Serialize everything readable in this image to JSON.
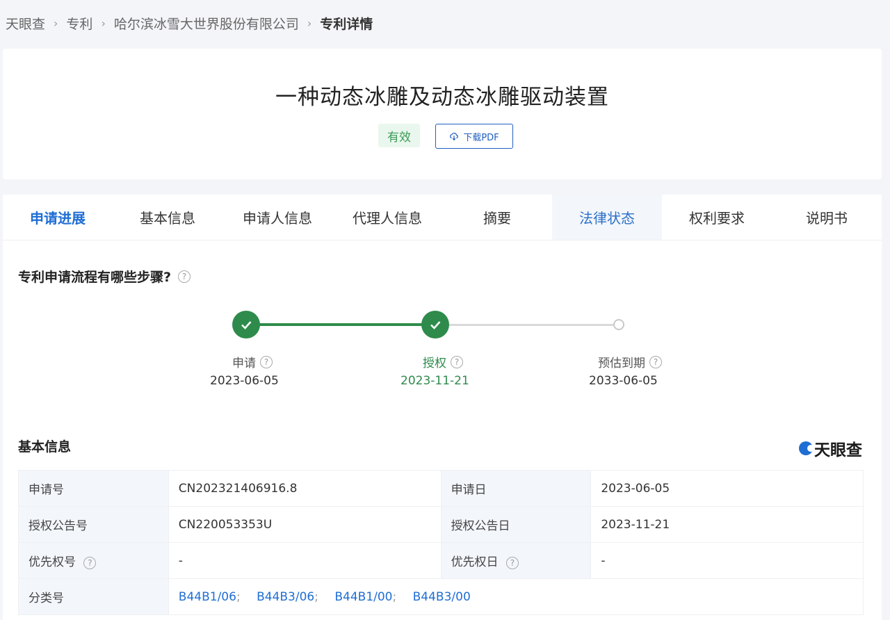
{
  "breadcrumb": {
    "items": [
      "天眼查",
      "专利",
      "哈尔滨冰雪大世界股份有限公司"
    ],
    "current": "专利详情",
    "separator": "›"
  },
  "patent": {
    "title": "一种动态冰雕及动态冰雕驱动装置",
    "status": "有效",
    "download_label": "下载PDF"
  },
  "tabs": [
    "申请进展",
    "基本信息",
    "申请人信息",
    "代理人信息",
    "摘要",
    "法律状态",
    "权利要求",
    "说明书"
  ],
  "progress": {
    "title": "专利申请流程有哪些步骤?",
    "steps": [
      {
        "label": "申请",
        "date": "2023-06-05",
        "done": true
      },
      {
        "label": "授权",
        "date": "2023-11-21",
        "done": true
      },
      {
        "label": "预估到期",
        "date": "2033-06-05",
        "done": false
      }
    ]
  },
  "basic_info": {
    "title": "基本信息",
    "logo_text": "天眼查",
    "rows": [
      {
        "l1": "申请号",
        "v1": "CN202321406916.8",
        "l2": "申请日",
        "v2": "2023-06-05"
      },
      {
        "l1": "授权公告号",
        "v1": "CN220053353U",
        "l2": "授权公告日",
        "v2": "2023-11-21"
      },
      {
        "l1": "优先权号",
        "v1": "-",
        "l2": "优先权日",
        "v2": "-"
      }
    ],
    "classification_label": "分类号",
    "classifications": [
      "B44B1/06",
      "B44B3/06",
      "B44B1/00",
      "B44B3/00"
    ]
  },
  "colors": {
    "accent": "#1f6ed4",
    "success": "#2e8b4b"
  },
  "icons": [
    "help-icon",
    "check-icon",
    "cloud-download-icon"
  ]
}
